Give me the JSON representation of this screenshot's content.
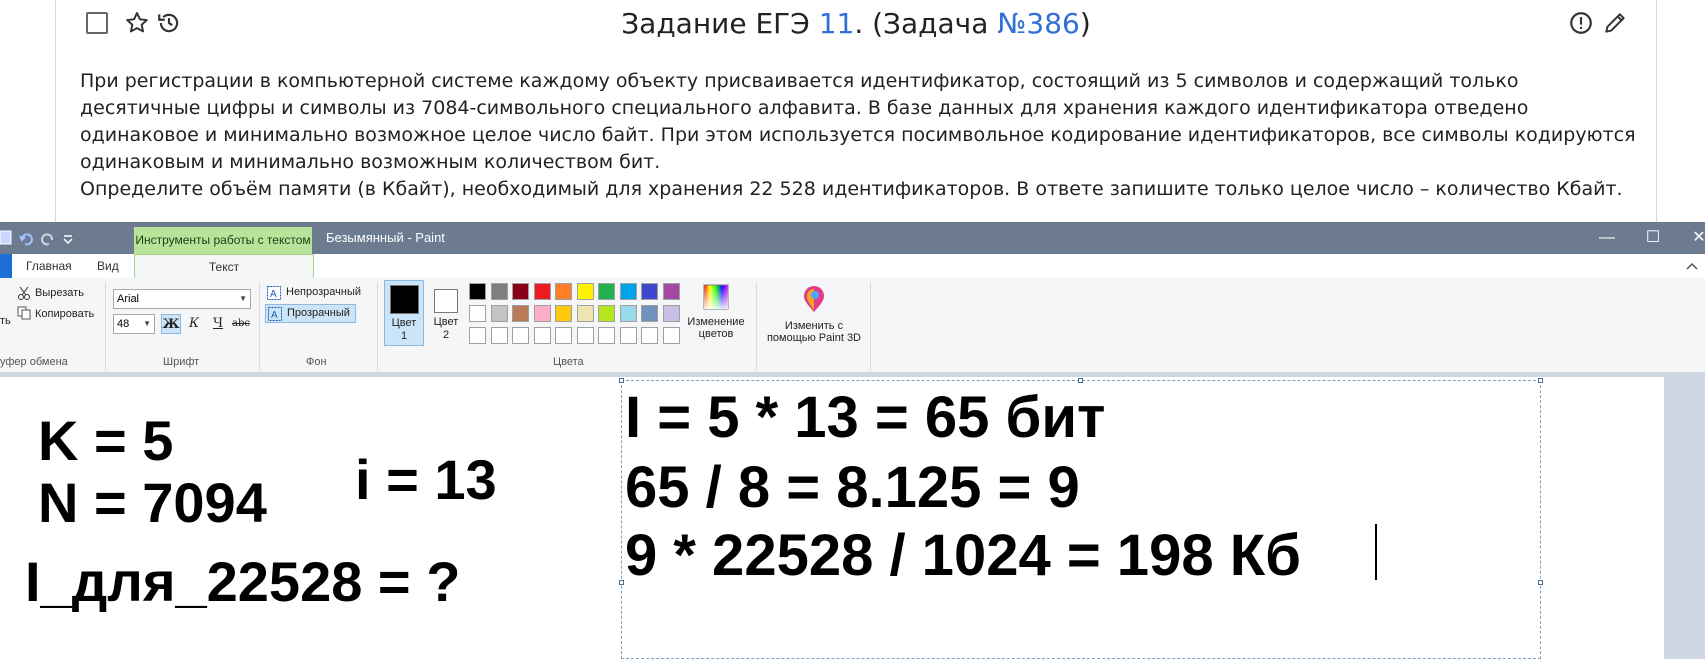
{
  "task": {
    "title_prefix": "Задание ЕГЭ ",
    "task_number": "11",
    "title_mid": ". (Задача ",
    "problem_link": "№386",
    "title_suffix": ")",
    "paragraphs": [
      "При регистрации в компьютерной системе каждому объекту присваивается идентификатор, состоящий из 5 символов и содержащий только десятичные цифры и символы из 7084-символьного специального алфавита. В базе данных для хранения каждого идентификатора отведено одинаковое и минимально возможное целое число байт. При этом используется посимвольное кодирование идентификаторов, все символы кодируются одинаковым и минимально возможным количеством бит.",
      "Определите объём памяти (в Кбайт), необходимый для хранения 22 528 идентификаторов. В ответе запишите только целое число – количество Кбайт."
    ]
  },
  "paint": {
    "contextual_tab": "Инструменты работы с текстом",
    "window_title": "Безымянный - Paint",
    "window_buttons": {
      "minimize": "—",
      "maximize": "☐",
      "close": "✕"
    },
    "tabs": {
      "home": "Главная",
      "view": "Вид",
      "text": "Текст"
    },
    "clipboard": {
      "paste_partial": "ть",
      "cut": "Вырезать",
      "copy": "Копировать",
      "group": "уфер обмена"
    },
    "font": {
      "family": "Arial",
      "size": "48",
      "bold": "Ж",
      "italic": "К",
      "underline": "Ч",
      "strike": "abc",
      "group": "Шрифт"
    },
    "background": {
      "opaque": "Непрозрачный",
      "transparent": "Прозрачный",
      "group": "Фон"
    },
    "colors": {
      "color1_line1": "Цвет",
      "color1_line2": "1",
      "color2_line1": "Цвет",
      "color2_line2": "2",
      "group": "Цвета",
      "edit_line1": "Изменение",
      "edit_line2": "цветов",
      "paint3d_line1": "Изменить с",
      "paint3d_line2": "помощью Paint 3D",
      "color1_value": "#000000",
      "color2_value": "#ffffff",
      "palette": [
        "#000000",
        "#7f7f7f",
        "#880015",
        "#ed1c24",
        "#ff7f27",
        "#fff200",
        "#22b14c",
        "#00a2e8",
        "#3f48cc",
        "#a349a4",
        "#ffffff",
        "#c3c3c3",
        "#b97a57",
        "#ffaec9",
        "#ffc90e",
        "#efe4b0",
        "#b5e61d",
        "#99d9ea",
        "#7092be",
        "#c8bfe7",
        "#ffffff",
        "#ffffff",
        "#ffffff",
        "#ffffff",
        "#ffffff",
        "#ffffff",
        "#ffffff",
        "#ffffff",
        "#ffffff",
        "#ffffff"
      ]
    },
    "canvas": {
      "k": "K = 5",
      "n": "N = 7094",
      "i": "i = 13",
      "question": "I_для_22528 = ?",
      "line1": "I = 5 * 13 = 65 бит",
      "line2": "65 / 8 = 8.125 = 9",
      "line3": "9 * 22528 / 1024 = 198 Кб"
    }
  }
}
